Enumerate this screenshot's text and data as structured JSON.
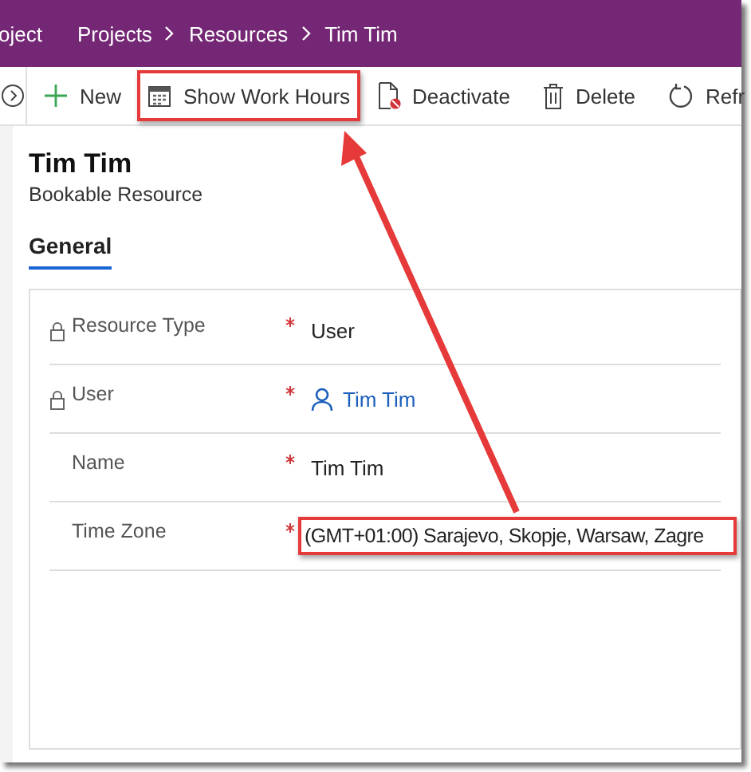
{
  "header": {
    "app_name": "oject",
    "breadcrumbs": [
      "Projects",
      "Resources",
      "Tim Tim"
    ]
  },
  "toolbar": {
    "commands": [
      {
        "label": "New",
        "highlighted": false
      },
      {
        "label": "Show Work Hours",
        "highlighted": true
      },
      {
        "label": "Deactivate",
        "highlighted": false
      },
      {
        "label": "Delete",
        "highlighted": false
      },
      {
        "label": "Refr",
        "highlighted": false
      }
    ]
  },
  "record": {
    "title": "Tim Tim",
    "entity": "Bookable Resource"
  },
  "tabs": [
    {
      "label": "General",
      "selected": true
    }
  ],
  "fields": [
    {
      "label": "Resource Type",
      "locked": true,
      "required": true,
      "kind": "text",
      "value": "User",
      "highlighted": false
    },
    {
      "label": "User",
      "locked": true,
      "required": true,
      "kind": "lookup",
      "value": "Tim Tim",
      "highlighted": false
    },
    {
      "label": "Name",
      "locked": false,
      "required": true,
      "kind": "text",
      "value": "Tim Tim",
      "highlighted": false
    },
    {
      "label": "Time Zone",
      "locked": false,
      "required": true,
      "kind": "text",
      "value": "(GMT+01:00) Sarajevo, Skopje, Warsaw, Zagre",
      "highlighted": true
    }
  ]
}
